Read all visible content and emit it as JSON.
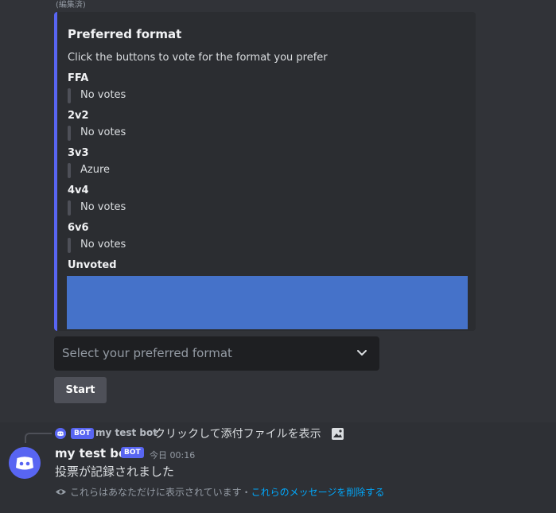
{
  "edited_label": "(編集済)",
  "embed": {
    "accent_color": "#5865f2",
    "title": "Preferred format",
    "description": "Click the buttons to vote for the format you prefer",
    "fields": [
      {
        "name": "FFA",
        "value": "No votes"
      },
      {
        "name": "2v2",
        "value": "No votes"
      },
      {
        "name": "3v3",
        "value": "Azure"
      },
      {
        "name": "4v4",
        "value": "No votes"
      },
      {
        "name": "6v6",
        "value": "No votes"
      }
    ],
    "unvoted_label": "Unvoted",
    "image_color": "#4572c9"
  },
  "select_menu": {
    "placeholder": "Select your preferred format",
    "icon": "chevron-down-icon"
  },
  "start_button": {
    "label": "Start"
  },
  "reply": {
    "bot_badge": "BOT",
    "author": "my test bot",
    "text": "クリックして添付ファイルを表示",
    "icon": "image-icon"
  },
  "message": {
    "author": "my test bot",
    "bot_badge": "BOT",
    "timestamp": "今日 00:16",
    "content": "投票が記録されました",
    "ephemeral_note": "これらはあなただけに表示されています・",
    "dismiss_link": "これらのメッセージを削除する"
  },
  "colors": {
    "background": "#313338",
    "embed_background": "#2b2d31",
    "select_background": "#1e1f22",
    "button_background": "#4e5058",
    "blurple": "#5865f2",
    "link": "#00a8fc"
  }
}
